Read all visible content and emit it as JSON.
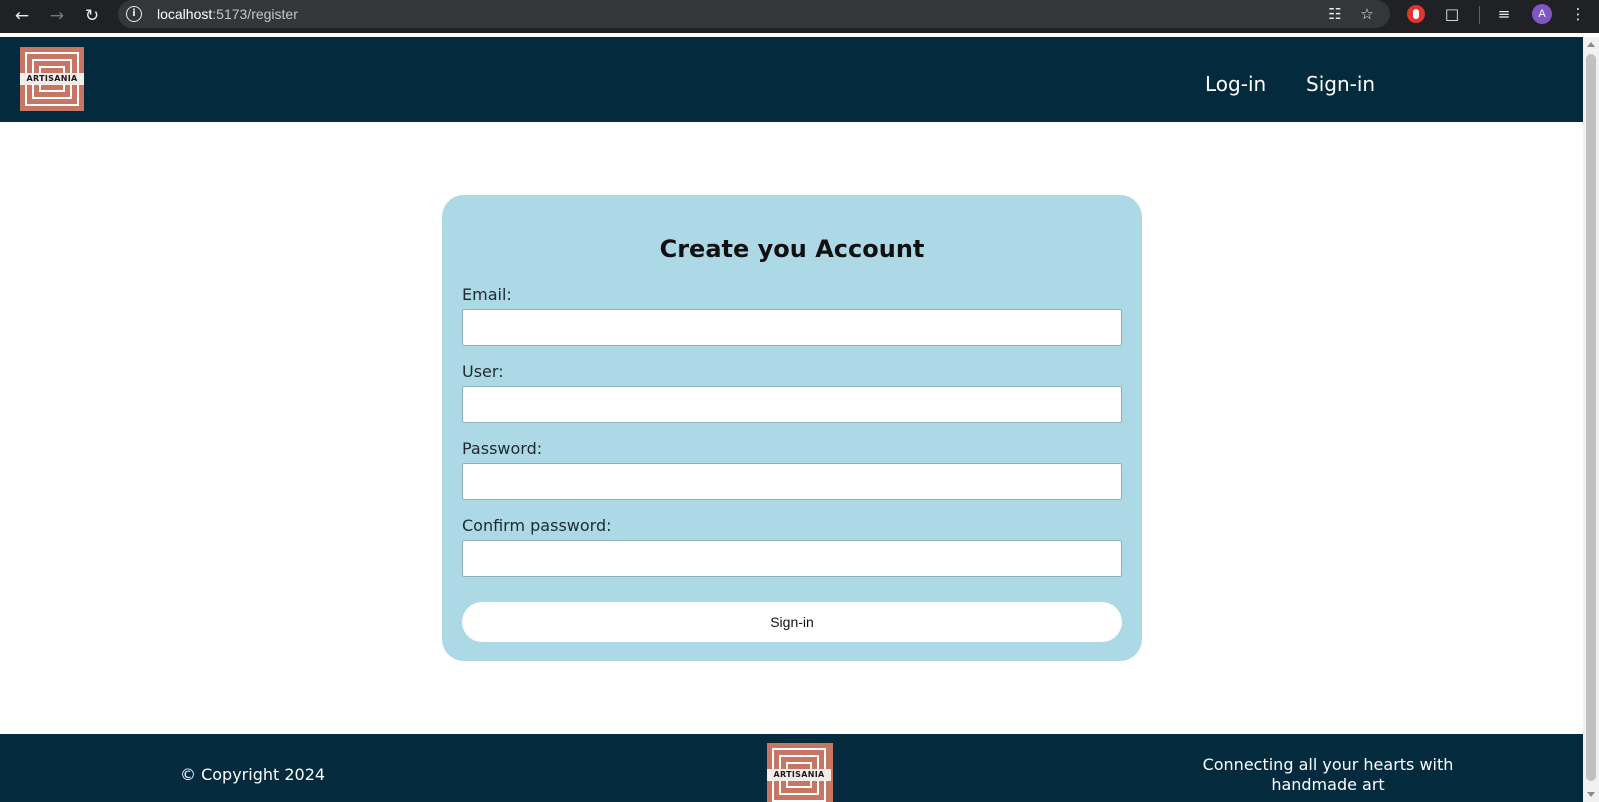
{
  "browser": {
    "url_host": "localhost",
    "url_path": ":5173/register",
    "profile_initial": "A",
    "icons": [
      "back-icon",
      "forward-icon",
      "reload-icon",
      "info-icon",
      "translate-icon",
      "star-icon",
      "extension-icon",
      "puzzle-icon",
      "media-icon",
      "menu-icon"
    ]
  },
  "header": {
    "logo_text": "ARTISANIA",
    "nav": [
      {
        "label": "Log-in"
      },
      {
        "label": "Sign-in"
      }
    ]
  },
  "form": {
    "title": "Create you Account",
    "fields": [
      {
        "label": "Email:",
        "value": ""
      },
      {
        "label": "User:",
        "value": ""
      },
      {
        "label": "Password:",
        "value": ""
      },
      {
        "label": "Confirm password:",
        "value": ""
      }
    ],
    "submit_label": "Sign-in"
  },
  "footer": {
    "copyright": "© Copyright 2024",
    "logo_text": "ARTISANIA",
    "tagline": "Connecting all your hearts with handmade art"
  },
  "colors": {
    "header_bg": "#042a3e",
    "card_bg": "#add8e6",
    "logo_bg": "#c87563"
  }
}
